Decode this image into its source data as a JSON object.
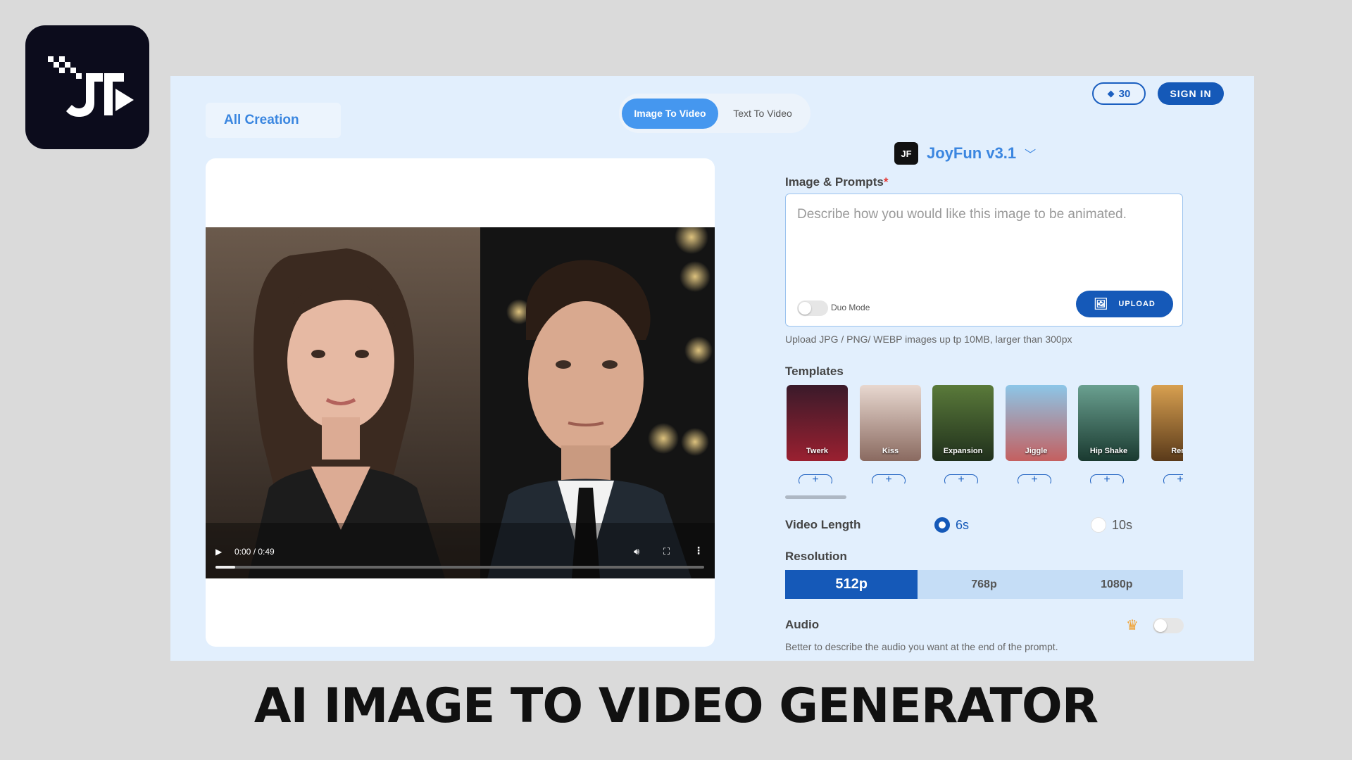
{
  "app": {
    "credits": "30",
    "sign_in": "SIGN IN",
    "all_creation": "All Creation",
    "tabs": [
      {
        "label": "Image To Video",
        "active": true
      },
      {
        "label": "Text To Video",
        "active": false
      }
    ]
  },
  "player": {
    "time": "0:00 / 0:49",
    "progress_fraction": 0.04
  },
  "model": {
    "icon_text": "JF",
    "name": "JoyFun v3.1"
  },
  "prompt": {
    "label": "Image & Prompts",
    "required_mark": "*",
    "placeholder": "Describe how you would like this image to be animated.",
    "duo_mode": "Duo Mode",
    "upload": "UPLOAD",
    "hint": "Upload JPG / PNG/ WEBP images up tp 10MB, larger than 300px"
  },
  "templates": {
    "label": "Templates",
    "items": [
      {
        "name": "Twerk",
        "color": "#7a1f2e"
      },
      {
        "name": "Kiss",
        "color": "#c9b0a8"
      },
      {
        "name": "Expansion",
        "color": "#3e5a2c"
      },
      {
        "name": "Jiggle",
        "color": "#6aa6c8"
      },
      {
        "name": "Hip Shake",
        "color": "#2f5a48"
      },
      {
        "name": "Remo",
        "color": "#b07a3a"
      }
    ]
  },
  "video_length": {
    "label": "Video Length",
    "options": [
      {
        "label": "6s",
        "selected": true
      },
      {
        "label": "10s",
        "selected": false
      }
    ]
  },
  "resolution": {
    "label": "Resolution",
    "options": [
      {
        "label": "512p",
        "selected": true
      },
      {
        "label": "768p",
        "selected": false
      },
      {
        "label": "1080p",
        "selected": false
      }
    ]
  },
  "audio": {
    "label": "Audio",
    "enabled": false,
    "hint": "Better to describe the audio you want at the end of the prompt."
  },
  "banner": {
    "title": "AI IMAGE TO VIDEO GENERATOR"
  },
  "colors": {
    "primary": "#1559b8",
    "accent": "#3b86e0",
    "panel": "#e2effd",
    "background": "#dadada"
  }
}
